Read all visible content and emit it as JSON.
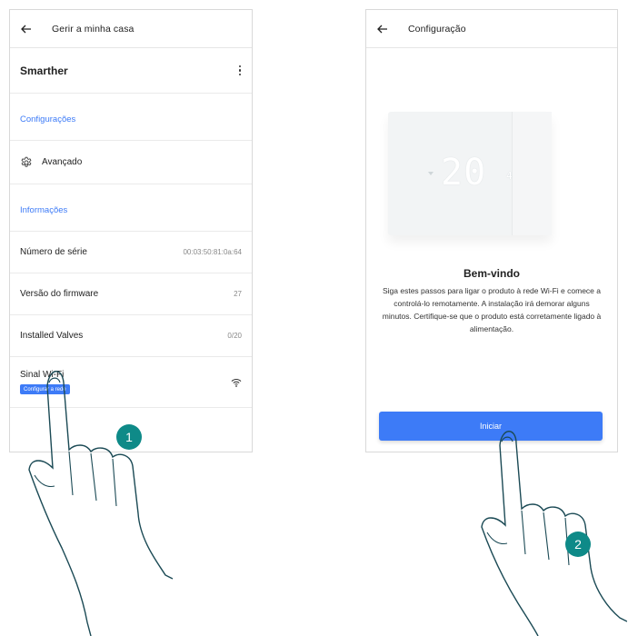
{
  "left_screen": {
    "title": "Gerir a minha casa",
    "device_name": "Smarther",
    "section_settings": "Configurações",
    "advanced_label": "Avançado",
    "section_info": "Informações",
    "rows": [
      {
        "label": "Número de série",
        "value": "00:03:50:81:0a:64"
      },
      {
        "label": "Versão do firmware",
        "value": "27"
      },
      {
        "label": "Installed Valves",
        "value": "0/20"
      }
    ],
    "wifi_label": "Sinal Wi-Fi",
    "configure_network_button": "Configurar a rede",
    "accent_color": "#3d7bf7"
  },
  "right_screen": {
    "title": "Configuração",
    "thermostat_display": "20",
    "thermostat_display_small": "4",
    "welcome_title": "Bem-vindo",
    "welcome_text": "Siga estes passos para ligar o produto à rede Wi-Fi e comece a controlá-lo remotamente. A instalação irá demorar alguns minutos. Certifique-se que o produto está corretamente ligado à alimentação.",
    "start_button": "Iniciar",
    "accent_color": "#3d7bf7"
  },
  "steps": [
    {
      "number": "1"
    },
    {
      "number": "2"
    }
  ],
  "badge_color": "#0e8a88",
  "icons": [
    "back-arrow-icon",
    "kebab-menu-icon",
    "gear-icon",
    "wifi-icon",
    "pointing-hand-icon"
  ]
}
